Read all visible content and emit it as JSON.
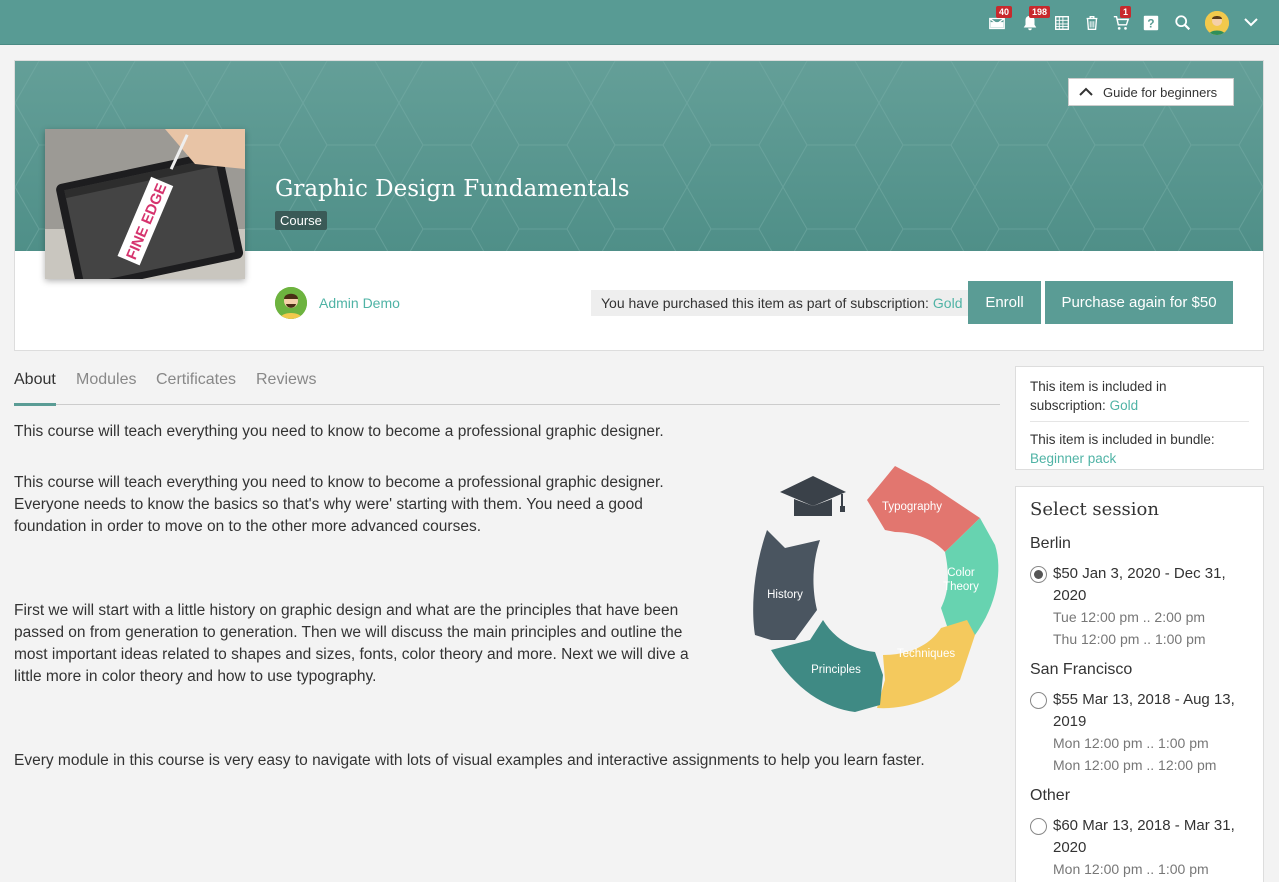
{
  "topbar": {
    "icons": [
      {
        "name": "mail-icon",
        "badge": "40"
      },
      {
        "name": "bell-icon",
        "badge": "198"
      },
      {
        "name": "calendar-icon",
        "badge": ""
      },
      {
        "name": "trash-icon",
        "badge": ""
      },
      {
        "name": "cart-icon",
        "badge": "1"
      },
      {
        "name": "help-icon",
        "badge": ""
      },
      {
        "name": "search-icon",
        "badge": ""
      }
    ],
    "mail_badge": "40",
    "bell_badge": "198",
    "cart_badge": "1"
  },
  "header": {
    "guide_label": "Guide for beginners",
    "title": "Graphic Design Fundamentals",
    "tag": "Course",
    "thumbnail_text": "FINE EDGE",
    "author": "Admin Demo",
    "purchased_note": "You have purchased this item as part of subscription:",
    "purchased_link": "Gold",
    "enroll_label": "Enroll",
    "purchase_label": "Purchase again for $50"
  },
  "tabs": [
    "About",
    "Modules",
    "Certificates",
    "Reviews"
  ],
  "content": {
    "intro": "This course will teach everything you need to know to become a professional graphic designer.",
    "p1_l1": "This course will teach everything you need to know to become a professional graphic designer.",
    "p1_l2": "Everyone needs to know the basics so that's why were' starting with them. You need a good",
    "p1_l3": "foundation in order to move on to the other more advanced courses.",
    "p2_l1": "First we will start with a little history on graphic design and what are the principles that have been",
    "p2_l2": "passed on from generation to generation. Then we will discuss the main principles and outline the",
    "p2_l3": "most important ideas related to shapes and sizes, fonts, color theory and more. Next we will dive a",
    "p2_l4": "little more in color theory and how to use typography.",
    "p3": "Every module in this course is very easy to navigate with lots of visual examples and interactive assignments to help you learn faster."
  },
  "diagram": {
    "labels": {
      "typography": "Typography",
      "color_l1": "Color",
      "color_l2": "Theory",
      "techniques": "Techniques",
      "principles": "Principles",
      "history": "History"
    },
    "colors": {
      "typography": "#e2766f",
      "color_theory": "#67d3b0",
      "techniques": "#f4c95d",
      "principles": "#3f8a84",
      "history": "#4a5560",
      "cap": "#3a4149"
    }
  },
  "sidebar": {
    "subscription_text_l1": "This item is included in",
    "subscription_text_l2": "subscription:",
    "subscription_link": "Gold",
    "bundle_text": "This item is included in bundle:",
    "bundle_link": "Beginner pack",
    "session_title": "Select session",
    "sessions": [
      {
        "city": "Berlin",
        "price_l1": "$50 Jan 3, 2020 - Dec 31,",
        "price_l2": "2020",
        "times": [
          "Tue 12:00 pm .. 2:00 pm",
          "Thu 12:00 pm .. 1:00 pm"
        ],
        "selected": true
      },
      {
        "city": "San Francisco",
        "price_l1": "$55 Mar 13, 2018 - Aug 13,",
        "price_l2": "2019",
        "times": [
          "Mon 12:00 pm .. 1:00 pm",
          "Mon 12:00 pm .. 12:00 pm"
        ],
        "selected": false
      },
      {
        "city": "Other",
        "price_l1": "$60 Mar 13, 2018 - Mar 31,",
        "price_l2": "2020",
        "times": [
          "Mon 12:00 pm .. 1:00 pm"
        ],
        "selected": false
      }
    ]
  },
  "colors": {
    "brand": "#589b94",
    "link": "#4fb3a5",
    "badge": "#c8292d"
  }
}
